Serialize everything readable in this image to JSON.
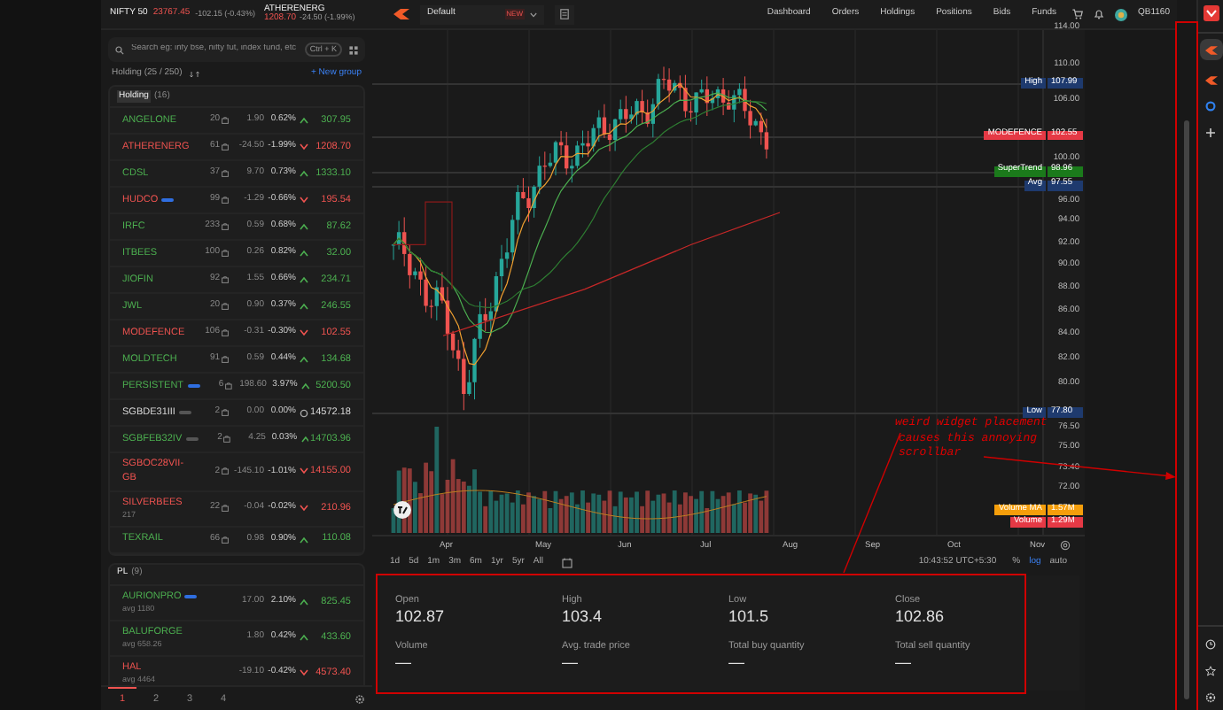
{
  "ticker": {
    "index_name": "NIFTY 50",
    "index_value": "23767.45",
    "index_change": "-102.15 (-0.43%)",
    "symbol": "ATHERENERG",
    "price": "1208.70",
    "change": "-24.50 (-1.99%)"
  },
  "workspace": {
    "name": "Default",
    "badge": "NEW"
  },
  "nav": [
    "Dashboard",
    "Orders",
    "Holdings",
    "Positions",
    "Bids",
    "Funds"
  ],
  "user": {
    "id": "QB1160"
  },
  "watchlist": {
    "search_placeholder": "Search eg: infy bse, nifty fut, index fund, etc",
    "shortcut": "Ctrl + K",
    "title": "Holding (25 / 250)",
    "new_group": "+ New group",
    "groups": [
      {
        "name": "Holding",
        "count": "(16)",
        "items": [
          {
            "symbol": "ANGELONE",
            "qty": "20",
            "change": "1.90",
            "pct": "0.62%",
            "kind": "up",
            "price": "307.95"
          },
          {
            "symbol": "ATHERENERG",
            "qty": "61",
            "change": "-24.50",
            "pct": "-1.99%",
            "kind": "down",
            "price": "1208.70"
          },
          {
            "symbol": "CDSL",
            "qty": "37",
            "change": "9.70",
            "pct": "0.73%",
            "kind": "up",
            "price": "1333.10"
          },
          {
            "symbol": "HUDCO",
            "qty": "99",
            "change": "-1.29",
            "pct": "-0.66%",
            "kind": "down",
            "price": "195.54",
            "tag": {
              "color": "#2f6ee0"
            }
          },
          {
            "symbol": "IRFC",
            "qty": "233",
            "change": "0.59",
            "pct": "0.68%",
            "kind": "up",
            "price": "87.62"
          },
          {
            "symbol": "ITBEES",
            "qty": "100",
            "change": "0.26",
            "pct": "0.82%",
            "kind": "up",
            "price": "32.00"
          },
          {
            "symbol": "JIOFIN",
            "qty": "92",
            "change": "1.55",
            "pct": "0.66%",
            "kind": "up",
            "price": "234.71"
          },
          {
            "symbol": "JWL",
            "qty": "20",
            "change": "0.90",
            "pct": "0.37%",
            "kind": "up",
            "price": "246.55"
          },
          {
            "symbol": "MODEFENCE",
            "qty": "106",
            "change": "-0.31",
            "pct": "-0.30%",
            "kind": "down",
            "price": "102.55"
          },
          {
            "symbol": "MOLDTECH",
            "qty": "91",
            "change": "0.59",
            "pct": "0.44%",
            "kind": "up",
            "price": "134.68"
          },
          {
            "symbol": "PERSISTENT",
            "qty": "6",
            "change": "198.60",
            "pct": "3.97%",
            "kind": "up",
            "price": "5200.50",
            "tag": {
              "color": "#2f6ee0"
            }
          },
          {
            "symbol": "SGBDE31III",
            "qty": "2",
            "change": "0.00",
            "pct": "0.00%",
            "kind": "flat",
            "price": "14572.18",
            "tag": {
              "color": "#555555"
            }
          },
          {
            "symbol": "SGBFEB32IV",
            "qty": "2",
            "change": "4.25",
            "pct": "0.03%",
            "kind": "up",
            "price": "14703.96",
            "tag": {
              "color": "#555555"
            }
          },
          {
            "symbol": "SGBOC28VII-GB",
            "qty": "2",
            "change": "-145.10",
            "pct": "-1.01%",
            "kind": "down",
            "price": "14155.00"
          },
          {
            "symbol": "SILVERBEES",
            "qty": "22",
            "change": "-0.04",
            "pct": "-0.02%",
            "kind": "down",
            "price": "210.96",
            "sub": "217"
          },
          {
            "symbol": "TEXRAIL",
            "qty": "66",
            "change": "0.98",
            "pct": "0.90%",
            "kind": "up",
            "price": "110.08"
          }
        ]
      },
      {
        "name": "PL",
        "count": "(9)",
        "items": [
          {
            "symbol": "AURIONPRO",
            "sub": "avg 1180",
            "change": "17.00",
            "pct": "2.10%",
            "kind": "up",
            "price": "825.45",
            "tag": {
              "color": "#2f6ee0"
            }
          },
          {
            "symbol": "BALUFORGE",
            "sub": "avg 658.26",
            "change": "1.80",
            "pct": "0.42%",
            "kind": "up",
            "price": "433.60"
          },
          {
            "symbol": "HAL",
            "sub": "avg 4464",
            "change": "-19.10",
            "pct": "-0.42%",
            "kind": "down",
            "price": "4573.40"
          }
        ]
      }
    ],
    "pages": [
      {
        "label": "1",
        "selected": true
      },
      {
        "label": "2",
        "selected": false
      },
      {
        "label": "3",
        "selected": false
      },
      {
        "label": "4",
        "selected": false
      }
    ]
  },
  "chart": {
    "price_ticks": [
      "114.00",
      "110.00",
      "106.00",
      "100.00",
      "96.00",
      "94.00",
      "92.00",
      "90.00",
      "88.00",
      "86.00",
      "84.00",
      "82.00",
      "80.00",
      "76.50",
      "75.00",
      "73.40",
      "72.00"
    ],
    "tags": [
      {
        "kind": "price",
        "label": "High",
        "value": "107.99",
        "color": "#1e3a6e"
      },
      {
        "kind": "price",
        "label": "MODEFENCE",
        "value": "102.55",
        "color": "#e53945"
      },
      {
        "kind": "price",
        "label": "SuperTrend",
        "value": "98.96",
        "color": "#1b7a1b"
      },
      {
        "kind": "price",
        "label": "Avg",
        "value": "97.55",
        "color": "#1e3a6e"
      },
      {
        "kind": "price",
        "label": "Low",
        "value": "77.80",
        "color": "#1e3a6e"
      },
      {
        "kind": "volume",
        "label": "Volume MA",
        "value": "1.57M",
        "color": "#f59e0b"
      },
      {
        "kind": "volume",
        "label": "Volume",
        "value": "1.29M",
        "color": "#e53945"
      }
    ],
    "months": [
      "Apr",
      "May",
      "Jun",
      "Jul",
      "Aug",
      "Sep",
      "Oct",
      "Nov"
    ],
    "ranges": [
      "1d",
      "5d",
      "1m",
      "3m",
      "6m",
      "1yr",
      "5yr",
      "All"
    ],
    "time": "10:43:52 UTC+5:30",
    "scales": [
      {
        "label": "%",
        "selected": false
      },
      {
        "label": "log",
        "selected": true
      },
      {
        "label": "auto",
        "selected": false
      }
    ]
  },
  "quote": [
    {
      "label": "Open",
      "value": "102.87"
    },
    {
      "label": "High",
      "value": "103.4"
    },
    {
      "label": "Low",
      "value": "101.5"
    },
    {
      "label": "Close",
      "value": "102.86"
    },
    {
      "label": "Volume",
      "value": "—"
    },
    {
      "label": "Avg. trade price",
      "value": "—"
    },
    {
      "label": "Total buy quantity",
      "value": "—"
    },
    {
      "label": "Total sell quantity",
      "value": "—"
    }
  ],
  "annotation": [
    "weird widget placement",
    "causes this annoying",
    "scrollbar"
  ]
}
